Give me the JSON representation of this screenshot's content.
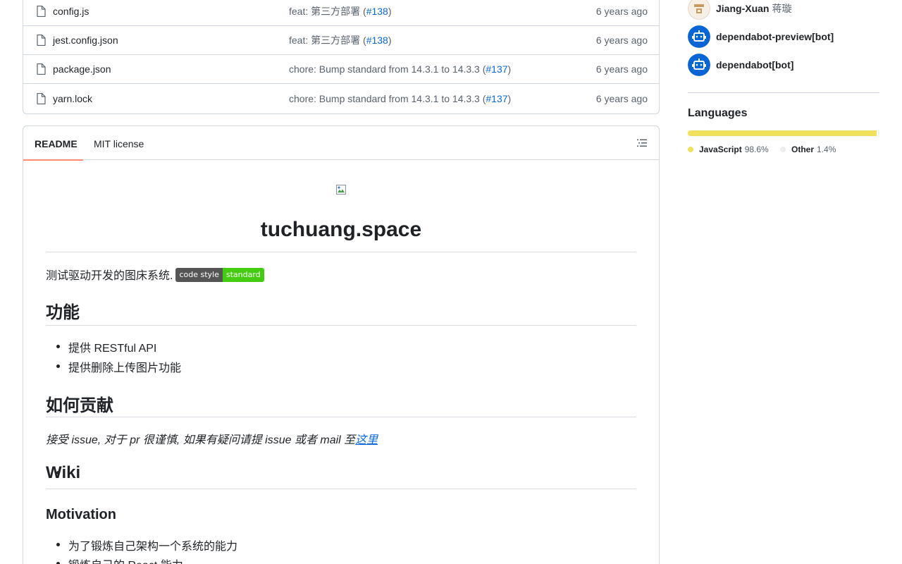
{
  "files": [
    {
      "name": "config.js",
      "message": "feat: 第三方部署 (",
      "pr": "#138",
      "message_end": ")",
      "date": "6 years ago"
    },
    {
      "name": "jest.config.json",
      "message": "feat: 第三方部署 (",
      "pr": "#138",
      "message_end": ")",
      "date": "6 years ago"
    },
    {
      "name": "package.json",
      "message": "chore: Bump standard from 14.3.1 to 14.3.3 (",
      "pr": "#137",
      "message_end": ")",
      "date": "6 years ago"
    },
    {
      "name": "yarn.lock",
      "message": "chore: Bump standard from 14.3.1 to 14.3.3 (",
      "pr": "#137",
      "message_end": ")",
      "date": "6 years ago"
    }
  ],
  "readme": {
    "tabs": {
      "readme": "README",
      "license": "MIT license"
    },
    "title": "tuchuang.space",
    "intro": "测试驱动开发的图床系统.",
    "badge": {
      "left": "code style",
      "right": "standard"
    },
    "features_heading": "功能",
    "features": [
      "提供 RESTful API",
      "提供删除上传图片功能"
    ],
    "contribute_heading": "如何贡献",
    "contribute_text": "接受 issue, 对于 pr 很谨慎, 如果有疑问请提 issue 或者 mail 至",
    "contribute_link": "这里",
    "wiki_heading": "Wiki",
    "motivation_heading": "Motivation",
    "motivation": [
      "为了锻炼自己架构一个系统的能力",
      "锻炼自己的 React 能力"
    ]
  },
  "sidebar": {
    "contributors": [
      {
        "name": "Jiang-Xuan",
        "sub": "蒋璇"
      },
      {
        "name": "dependabot-preview[bot]",
        "sub": ""
      },
      {
        "name": "dependabot[bot]",
        "sub": ""
      }
    ],
    "languages_title": "Languages",
    "languages": [
      {
        "name": "JavaScript",
        "percent": "98.6%",
        "value": 98.6,
        "color": "#f1e05a"
      },
      {
        "name": "Other",
        "percent": "1.4%",
        "value": 1.4,
        "color": "#ededed"
      }
    ]
  }
}
